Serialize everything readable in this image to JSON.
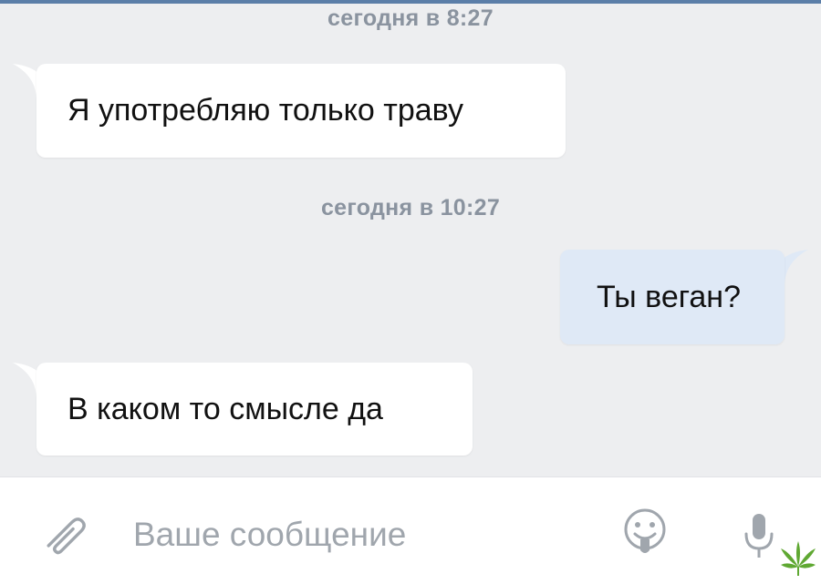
{
  "chat": {
    "messages": [
      {
        "date": "сегодня в 8:27",
        "text": "Я употребляю только траву",
        "direction": "incoming"
      },
      {
        "date": "сегодня в 10:27",
        "text": "Ты веган?",
        "direction": "outgoing"
      },
      {
        "date": "",
        "text": "В каком то смысле да",
        "direction": "incoming"
      }
    ]
  },
  "composer": {
    "placeholder": "Ваше сообщение",
    "icons": {
      "attach": "paperclip-icon",
      "emoji": "smiley-icon",
      "mic": "microphone-icon"
    }
  },
  "watermark": {
    "icon": "cannabis-leaf-icon"
  },
  "colors": {
    "chat_background": "#edeef0",
    "incoming_bubble": "#ffffff",
    "outgoing_bubble": "#dfe9f6",
    "date_text": "#8a939f",
    "icon_gray": "#a0a6ad",
    "top_accent": "#5b7ea8",
    "leaf_green": "#5fa832"
  }
}
